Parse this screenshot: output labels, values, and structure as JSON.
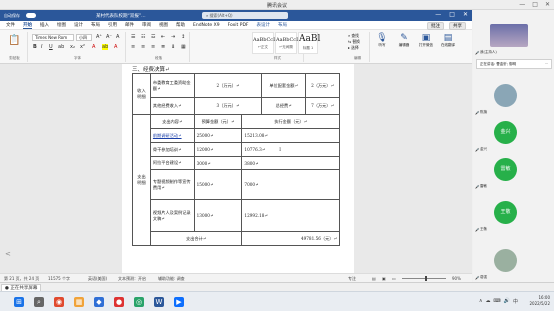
{
  "meeting": {
    "title": "腾讯会议",
    "controls": [
      "—",
      "□",
      "✕"
    ]
  },
  "word": {
    "autosave_label": "自动保存",
    "autosave_state": "关",
    "doc_title": "某村代表队校期“双报”…",
    "search_placeholder": "搜索(Alt+Q)",
    "window_controls": [
      "—",
      "□",
      "✕"
    ],
    "menu": [
      "文件",
      "开始",
      "插入",
      "绘图",
      "设计",
      "布局",
      "引用",
      "邮件",
      "审阅",
      "视图",
      "帮助",
      "EndNote X9",
      "Foxit PDF",
      "表设计",
      "布局"
    ],
    "menu_active": "开始",
    "comment_label": "批注",
    "share_label": "共享",
    "font_name": "Times New Rom",
    "font_size": "小四",
    "styles": [
      {
        "sample": "AaBbCcDc",
        "name": "↵正文"
      },
      {
        "sample": "AaBbCcDc",
        "name": "↵无间隔"
      },
      {
        "sample": "AaBl",
        "name": "标题 1"
      }
    ],
    "editing": [
      "查找",
      "替换",
      "选择"
    ],
    "tools": [
      {
        "glyph": "🎙",
        "label": "听写"
      },
      {
        "glyph": "✎",
        "label": "编辑器"
      },
      {
        "glyph": "▣",
        "label": "打开微信"
      },
      {
        "glyph": "▤",
        "label": "在线翻译"
      }
    ],
    "group_labels": [
      "剪贴板",
      "字体",
      "段落",
      "样式",
      "编辑",
      "语音",
      "编辑器",
      "微信",
      "翻译"
    ],
    "status": {
      "page": "第 21 页，共 24 页",
      "words": "11575 个字",
      "language": "英语(美国)",
      "accessibility": "文本预测：开启",
      "assist": "辅助功能: 调查",
      "focus": "专注",
      "zoom": "90%"
    }
  },
  "document": {
    "heading": "三、经费决算↵",
    "income_label": "收入\n明细",
    "expense_label": "支出\n明细",
    "rows_income": [
      {
        "a": "市委教育工委资助金额↵",
        "b": "2（万元）↵",
        "c": "单位配套金额↵",
        "d": "2（万元）↵"
      },
      {
        "a": "其他经费收入↵",
        "b": "3（万元）↵",
        "c": "总经费↵",
        "d": "7（万元）↵"
      }
    ],
    "expense_header": {
      "a": "支出内容↵",
      "b": "预算金额（元）↵",
      "c": "执行金额（元）↵"
    },
    "rows_expense": [
      {
        "a": "前期调研活动↵",
        "b": "25000↵",
        "c": "15213.08↵"
      },
      {
        "a": "骨干参加培训↵",
        "b": "12000↵",
        "c": "10776.3↵"
      },
      {
        "a": "阿拉平台建设↵",
        "b": "3000↵",
        "c": "3800↵"
      },
      {
        "a": "专题视频制作等宣传费用↵",
        "b": "15000↵",
        "c": "7000↵"
      },
      {
        "a": "视频片人及案例记录文稿↵",
        "b": "13000↵",
        "c": "12992.18↵"
      }
    ],
    "total_label": "支出合计↵",
    "total_value": "49781.56（元）↵"
  },
  "participants": {
    "toolbar": [
      "正在讲话: 曹金忻; 御明",
      "⋯"
    ],
    "tiles": [
      {
        "name": "我(主持人)",
        "initials": "",
        "color": "#6a6f9a"
      },
      {
        "name": "陈旗",
        "initials": "",
        "color": "#8aa6b6"
      },
      {
        "name": "金兴",
        "initials": "金兴",
        "color": "#27b04a"
      },
      {
        "name": "雷敏",
        "initials": "雷敏",
        "color": "#27b04a"
      },
      {
        "name": "王敬",
        "initials": "王敬",
        "color": "#27b04a"
      },
      {
        "name": "葛强",
        "initials": "",
        "color": "#9ab0a0"
      }
    ]
  },
  "share_bar": {
    "label": "● 正在共享屏幕"
  },
  "taskbar": {
    "apps": [
      {
        "glyph": "⊞",
        "color": "#1a73e8",
        "name": "start"
      },
      {
        "glyph": "⌕",
        "color": "#555555",
        "name": "search"
      },
      {
        "glyph": "◉",
        "color": "#e04a2f",
        "name": "browser"
      },
      {
        "glyph": "▦",
        "color": "#f0a33a",
        "name": "files"
      },
      {
        "glyph": "◆",
        "color": "#2f6fd6",
        "name": "app-1"
      },
      {
        "glyph": "●",
        "color": "#d33",
        "name": "app-2"
      },
      {
        "glyph": "◎",
        "color": "#29a36a",
        "name": "wechat"
      },
      {
        "glyph": "W",
        "color": "#2b579a",
        "name": "word"
      },
      {
        "glyph": "▶",
        "color": "#0d6efd",
        "name": "meeting"
      }
    ],
    "tray_icons": [
      "∧",
      "☁",
      "⌨",
      "🔊",
      "中"
    ],
    "time": "16:00",
    "date": "2022/5/22"
  }
}
